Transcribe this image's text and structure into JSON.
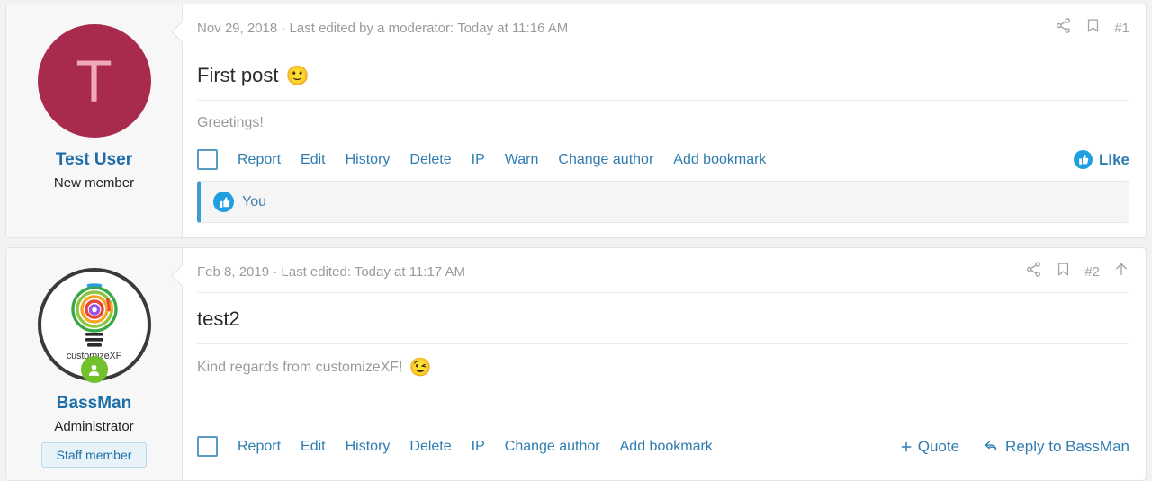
{
  "posts": [
    {
      "user": {
        "avatar_type": "letter",
        "avatar_letter": "T",
        "avatar_bg": "#a82a4d",
        "avatar_fg": "#f0a9bb",
        "name": "Test User",
        "title": "New member"
      },
      "header": {
        "date": "Nov 29, 2018 · Last edited by a moderator: Today at 11:16 AM",
        "post_number": "#1"
      },
      "title": "First post",
      "title_emoji": "🙂",
      "body": "Greetings!",
      "body_emoji": "",
      "actions": [
        "Report",
        "Edit",
        "History",
        "Delete",
        "IP",
        "Warn",
        "Change author",
        "Add bookmark"
      ],
      "like_label": "Like",
      "reaction": {
        "text": "You"
      }
    },
    {
      "user": {
        "avatar_type": "logo",
        "logo_label": "customizeXF",
        "name": "BassMan",
        "title": "Administrator",
        "staff_badge": "Staff member",
        "online": true
      },
      "header": {
        "date": "Feb 8, 2019 · Last edited: Today at 11:17 AM",
        "post_number": "#2"
      },
      "title": "test2",
      "title_emoji": "",
      "body": "Kind regards from customizeXF!",
      "body_emoji": "😉",
      "actions": [
        "Report",
        "Edit",
        "History",
        "Delete",
        "IP",
        "Change author",
        "Add bookmark"
      ],
      "quote_label": "Quote",
      "reply_label": "Reply to BassMan"
    }
  ],
  "colors": {
    "link": "#2e7cb0",
    "username": "#1d6ea8",
    "accent_blue": "#1f9fe0",
    "online_green": "#72c02c"
  }
}
